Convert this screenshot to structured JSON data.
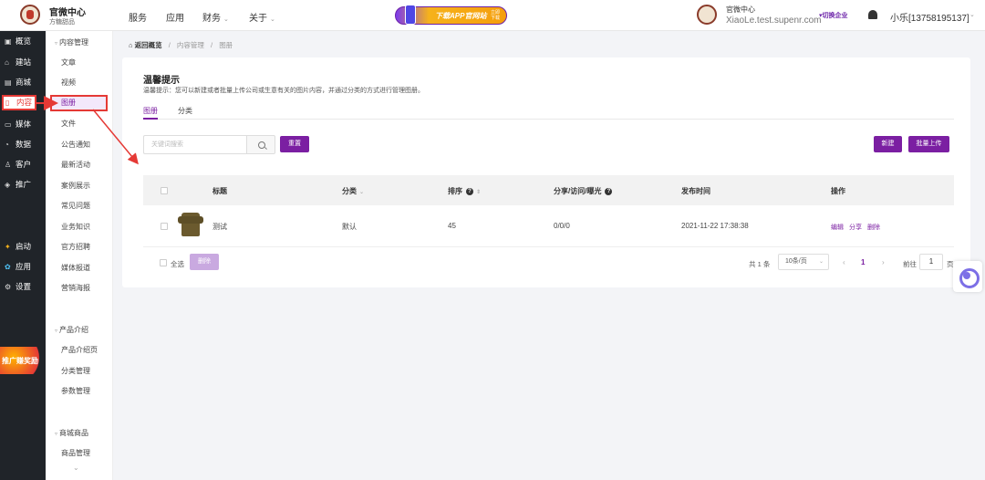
{
  "header": {
    "brand_title": "官微中心",
    "brand_sub": "方糖甜品",
    "nav": [
      {
        "label": "服务",
        "chevron": false
      },
      {
        "label": "应用",
        "chevron": false
      },
      {
        "label": "财务",
        "chevron": true
      },
      {
        "label": "关于",
        "chevron": true
      }
    ],
    "banner_text": "下载APP官网站",
    "banner_small": "立即下载",
    "org_name": "官微中心",
    "org_domain": "XiaoLe.test.supenr.com",
    "switch_org": "▾切换企业",
    "username": "小乐[13758195137]",
    "chevron": "⌄"
  },
  "sidebar": {
    "items": [
      {
        "icon": "dashboard-icon",
        "glyph": "▣",
        "label": "概览"
      },
      {
        "icon": "home-icon",
        "glyph": "⌂",
        "label": "建站"
      },
      {
        "icon": "shop-icon",
        "glyph": "▤",
        "label": "商城"
      },
      {
        "icon": "document-icon",
        "glyph": "▯",
        "label": "内容"
      },
      {
        "icon": "media-icon",
        "glyph": "▭",
        "label": "媒体"
      },
      {
        "icon": "chart-icon",
        "glyph": "◔",
        "label": "数据"
      },
      {
        "icon": "user-icon",
        "glyph": "♙",
        "label": "客户"
      },
      {
        "icon": "tag-icon",
        "glyph": "◈",
        "label": "推广"
      },
      {
        "icon": "launch-icon",
        "glyph": "✦",
        "label": "启动"
      },
      {
        "icon": "apps-icon",
        "glyph": "✿",
        "label": "应用"
      },
      {
        "icon": "gear-icon",
        "glyph": "⚙",
        "label": "设置"
      }
    ],
    "promo": "推广赚奖励"
  },
  "subsidebar": {
    "group1": "内容管理",
    "group1_items": [
      "文章",
      "视频",
      "图册",
      "文件",
      "公告通知",
      "最新活动",
      "案例展示",
      "常见问题",
      "业务知识",
      "官方招聘",
      "媒体报道",
      "营销海报"
    ],
    "group2": "产品介绍",
    "group2_items": [
      "产品介绍页",
      "分类管理",
      "参数管理"
    ],
    "group3": "商城商品",
    "group3_items": [
      "商品管理"
    ],
    "more": "⌄"
  },
  "breadcrumb": {
    "back": "返回概览",
    "sep": "/",
    "parent": "内容管理",
    "current": "图册"
  },
  "tip": {
    "title": "温馨提示",
    "text": "温馨提示：您可以新建或者批量上传公司或生意有关的图片内容，并通过分类的方式进行管理图册。"
  },
  "tabs": [
    "图册",
    "分类"
  ],
  "search": {
    "placeholder": "关键词搜索",
    "reset": "重置"
  },
  "actions": {
    "new": "新建",
    "batch_upload": "批量上传"
  },
  "table": {
    "headers": {
      "title": "标题",
      "category": "分类",
      "sort": "排序",
      "stats": "分享/访问/曝光",
      "time": "发布时间",
      "ops": "操作"
    },
    "rows": [
      {
        "title": "测试",
        "category": "默认",
        "sort": "45",
        "stats": "0/0/0",
        "time": "2021-11-22 17:38:38",
        "ops": [
          "编辑",
          "分享",
          "删除"
        ]
      }
    ]
  },
  "footer": {
    "select_all": "全选",
    "delete": "删除",
    "total": "共 1 条",
    "page_size": "10条/页",
    "prev": "‹",
    "next": "›",
    "current_page": "1",
    "goto": "前往",
    "goto_value": "1",
    "page_suffix": "页"
  },
  "colors": {
    "accent": "#7b1fa2",
    "annotation": "#e53935",
    "sidebar_bg": "#202429"
  }
}
